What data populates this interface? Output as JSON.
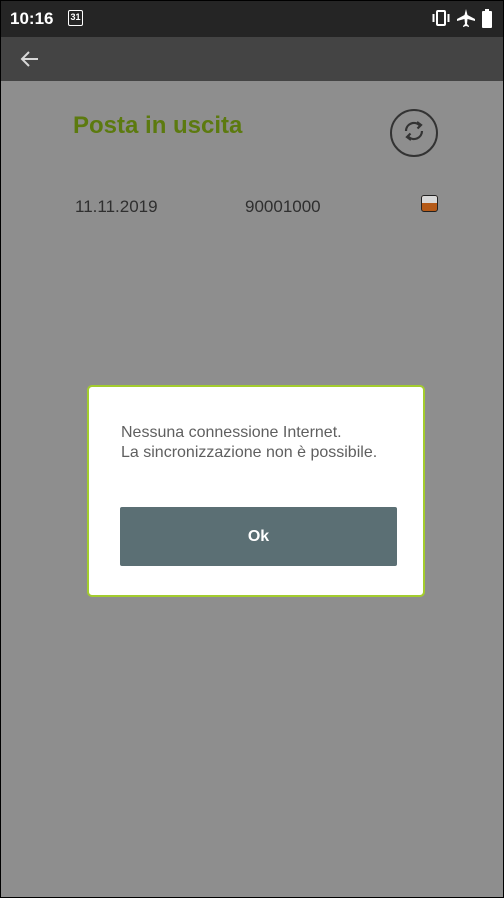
{
  "status_bar": {
    "time": "10:16",
    "calendar_day": "31",
    "icons": [
      "vibrate-icon",
      "airplane-mode-icon",
      "battery-icon"
    ]
  },
  "app_bar": {
    "back_icon": "back-arrow-icon"
  },
  "main": {
    "title": "Posta in uscita",
    "sync_icon": "sync-icon",
    "rows": [
      {
        "date": "11.11.2019",
        "number": "90001000",
        "status_icon": "half-filled-status-icon"
      }
    ]
  },
  "dialog": {
    "message": "Nessuna connessione Internet.\nLa sincronizzazione non è possibile.",
    "ok_label": "Ok"
  },
  "colors": {
    "title": "#5c7a0f",
    "dialog_border": "#a3cc2e",
    "ok_button": "#5b6f74",
    "overlay": "#8e8e8e",
    "status_bar": "#252525",
    "app_bar": "#444444"
  }
}
